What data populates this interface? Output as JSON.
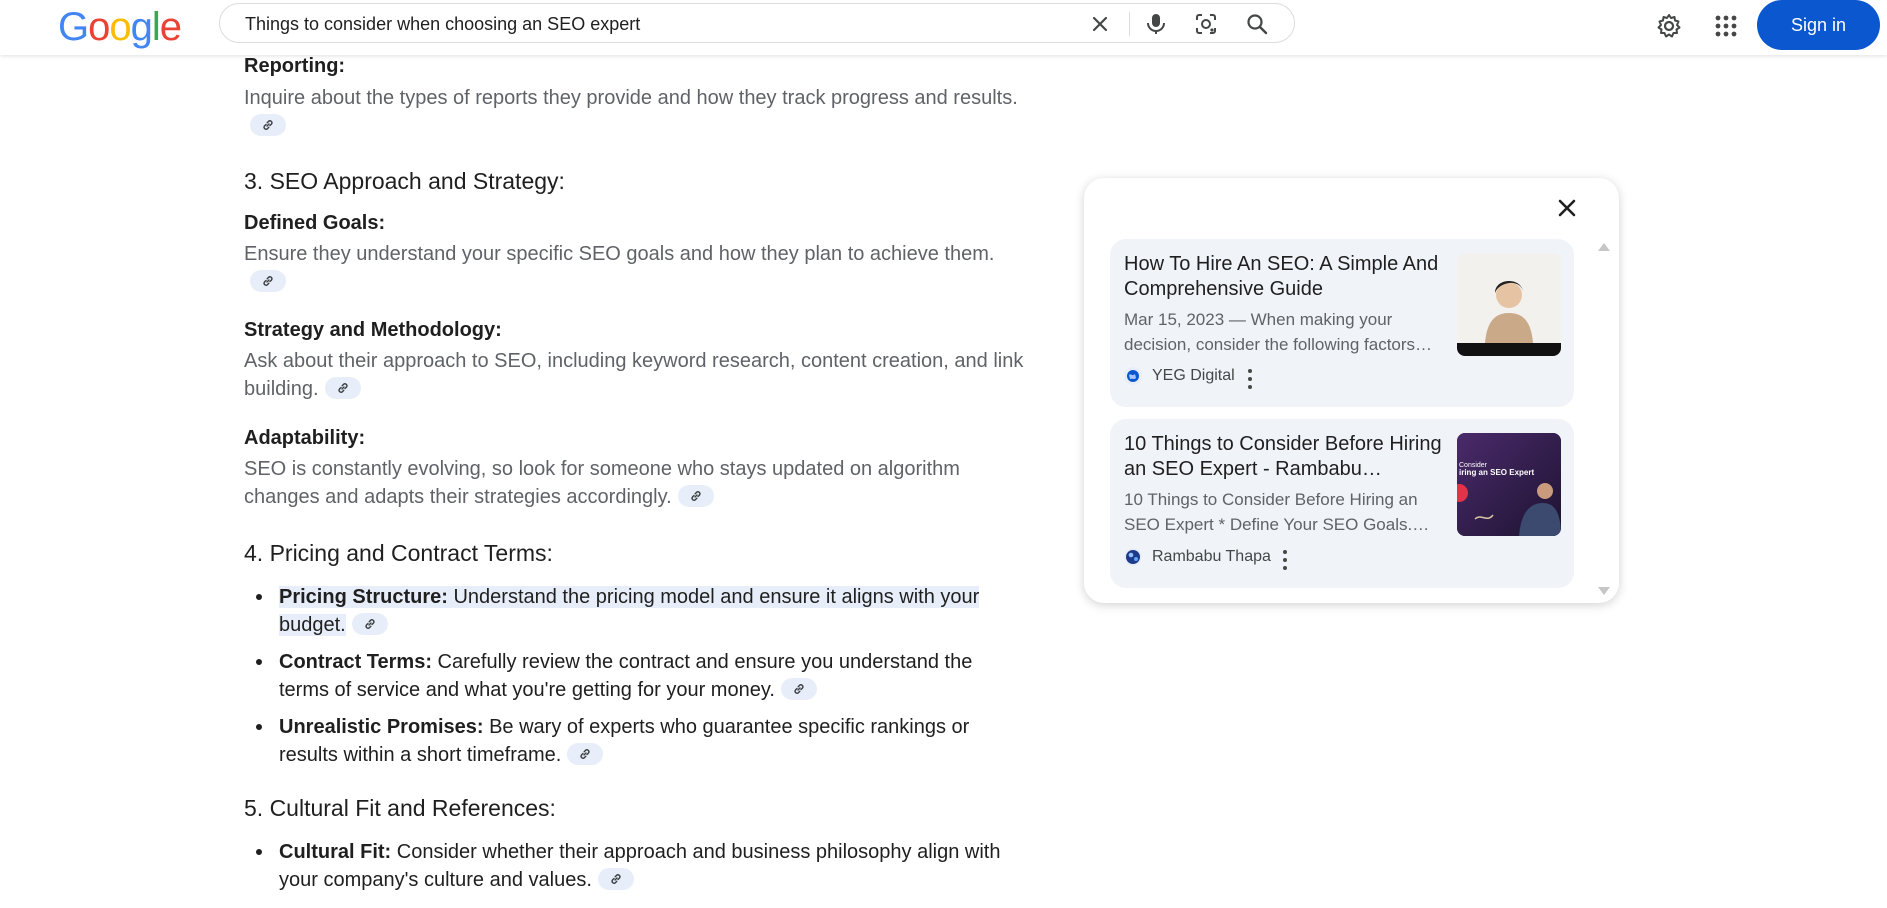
{
  "header": {
    "logo": [
      "G",
      "o",
      "o",
      "g",
      "l",
      "e"
    ],
    "search_value": "Things to consider when choosing an SEO expert",
    "sign_in_label": "Sign in"
  },
  "colors": {
    "accent": "#0b57d0",
    "logo_blue": "#4285F4",
    "logo_red": "#EA4335",
    "logo_yellow": "#FBBC05",
    "logo_green": "#34A853"
  },
  "icons": [
    "close-icon",
    "microphone-icon",
    "lens-icon",
    "search-icon",
    "gear-icon",
    "apps-grid-icon",
    "link-icon"
  ],
  "content": {
    "reporting_title": "Reporting:",
    "reporting_text": "Inquire about the types of reports they provide and how they track progress and results.",
    "section3_title": "3. SEO Approach and Strategy:",
    "defined_goals_title": "Defined Goals:",
    "defined_goals_text": "Ensure they understand your specific SEO goals and how they plan to achieve them.",
    "strategy_title": "Strategy and Methodology:",
    "strategy_text": "Ask about their approach to SEO, including keyword research, content creation, and link building.",
    "adaptability_title": "Adaptability:",
    "adaptability_text": "SEO is constantly evolving, so look for someone who stays updated on algorithm changes and adapts their strategies accordingly.",
    "section4_title": "4. Pricing and Contract Terms:",
    "bullets4": [
      {
        "label": "Pricing Structure:",
        "text": " Understand the pricing model and ensure it aligns with your budget."
      },
      {
        "label": "Contract Terms:",
        "text": " Carefully review the contract and ensure you understand the terms of service and what you're getting for your money."
      },
      {
        "label": "Unrealistic Promises:",
        "text": " Be wary of experts who guarantee specific rankings or results within a short timeframe."
      }
    ],
    "section5_title": "5. Cultural Fit and References:",
    "bullets5": [
      {
        "label": "Cultural Fit:",
        "text": " Consider whether their approach and business philosophy align with your company's culture and values."
      }
    ]
  },
  "sources": {
    "cards": [
      {
        "title": "How To Hire An SEO: A Simple And Comprehensive Guide",
        "snippet": "Mar 15, 2023 — When making your decision, consider the following factors…",
        "source": "YEG Digital"
      },
      {
        "title": "10 Things to Consider Before Hiring an SEO Expert - Rambabu…",
        "snippet": "10 Things to Consider Before Hiring an SEO Expert * Define Your SEO Goals.…",
        "source": "Rambabu Thapa",
        "thumb_text_1": "Consider",
        "thumb_text_2": "iring an SEO Expert"
      }
    ]
  }
}
